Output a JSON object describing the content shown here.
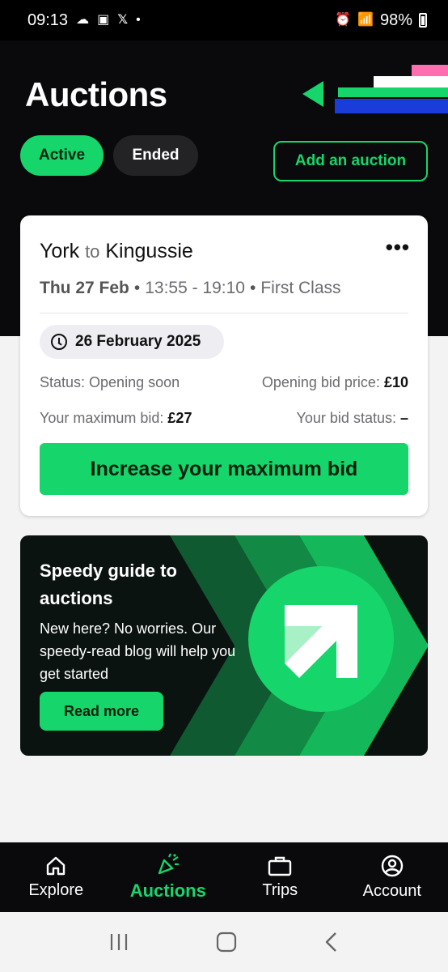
{
  "status_bar": {
    "time": "09:13",
    "battery": "98%"
  },
  "header": {
    "title": "Auctions"
  },
  "filters": {
    "active": "Active",
    "ended": "Ended",
    "add": "Add an auction"
  },
  "card": {
    "origin": "York",
    "connector": "to",
    "destination": "Kingussie",
    "more": "•••",
    "date": "Thu 27 Feb",
    "times": "13:55 - 19:10",
    "class": "First Class",
    "auction_date": "26 February 2025",
    "status_label": "Status: Opening soon",
    "opening_label": "Opening bid price:",
    "opening_value": "£10",
    "max_label": "Your maximum bid:",
    "max_value": "£27",
    "bid_status_label": "Your bid status:",
    "bid_status_value": "–",
    "cta": "Increase your maximum bid"
  },
  "guide": {
    "title": "Speedy guide to auctions",
    "body": "New here? No worries. Our speedy-read blog will help you get started",
    "cta": "Read more"
  },
  "nav": [
    {
      "label": "Explore",
      "icon": "home-icon"
    },
    {
      "label": "Auctions",
      "icon": "party-popper-icon",
      "active": true
    },
    {
      "label": "Trips",
      "icon": "briefcase-icon"
    },
    {
      "label": "Account",
      "icon": "account-icon"
    }
  ],
  "colors": {
    "accent": "#16d66b",
    "dark": "#0a0a0d"
  }
}
